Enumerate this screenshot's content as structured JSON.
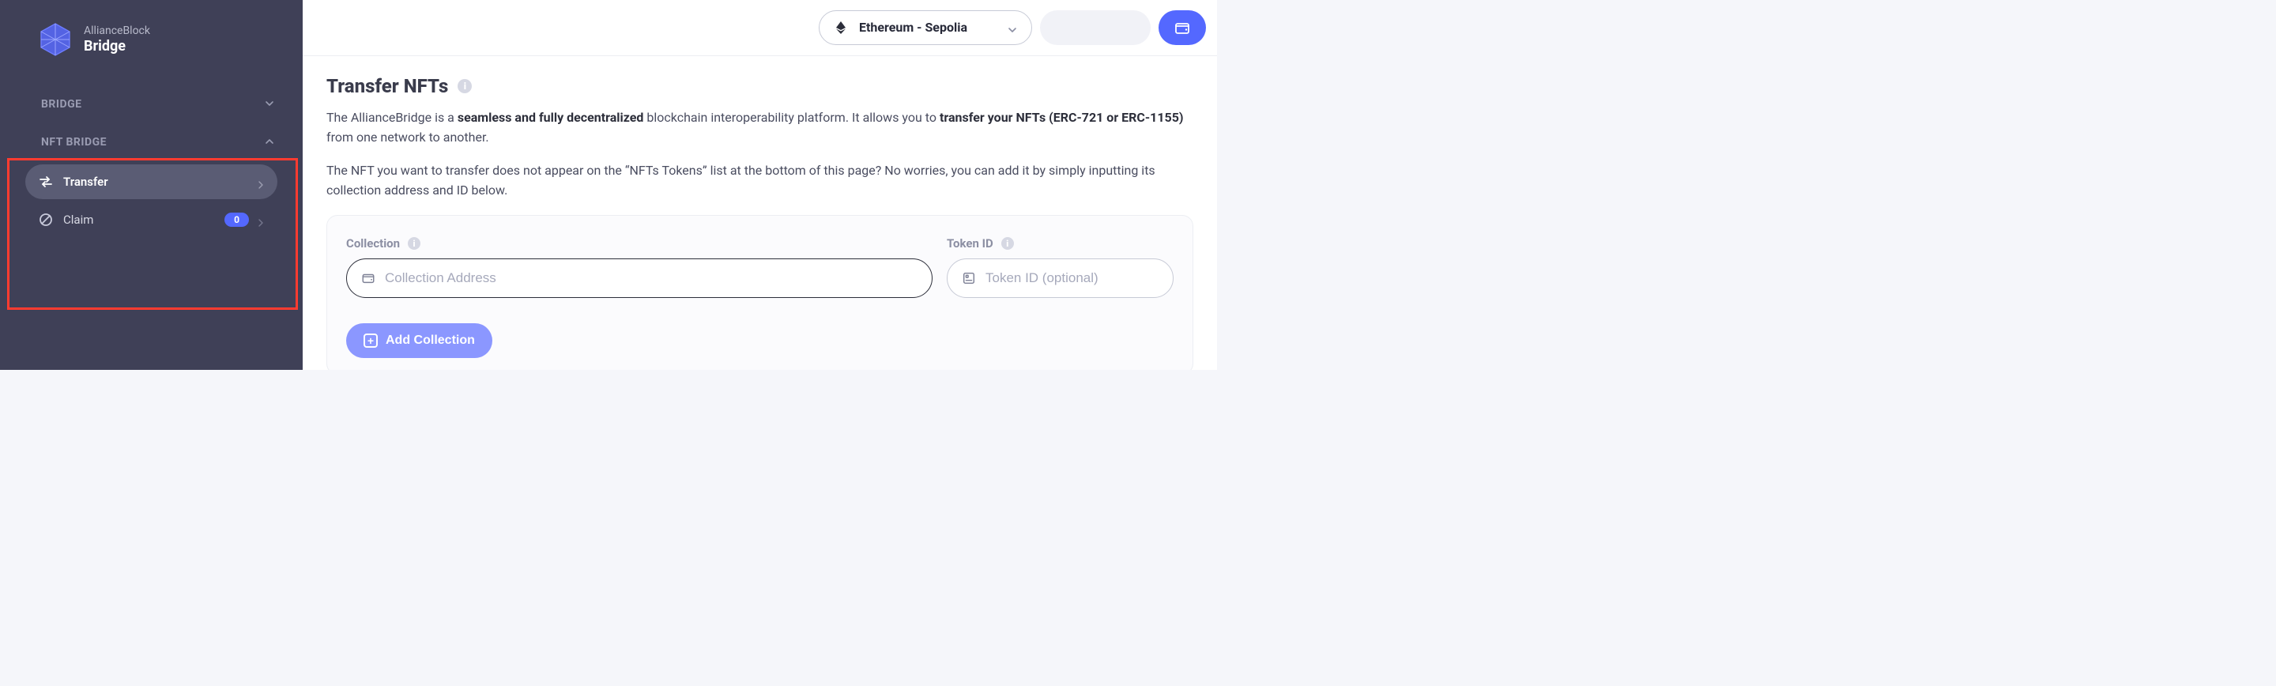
{
  "brand": {
    "top": "AllianceBlock",
    "bottom": "Bridge"
  },
  "sidebar": {
    "sections": [
      {
        "label": "BRIDGE",
        "expanded": false
      },
      {
        "label": "NFT BRIDGE",
        "expanded": true
      }
    ],
    "items": [
      {
        "label": "Transfer",
        "active": true
      },
      {
        "label": "Claim",
        "active": false,
        "badge": "0"
      }
    ]
  },
  "topbar": {
    "network_label": "Ethereum - Sepolia"
  },
  "page": {
    "title": "Transfer NFTs",
    "desc1_a": "The AllianceBridge is a ",
    "desc1_b": "seamless and fully decentralized",
    "desc1_c": " blockchain interoperability platform. It allows you to ",
    "desc1_d": "transfer your NFTs (ERC-721 or ERC-1155)",
    "desc1_e": " from one network to another.",
    "desc2": "The NFT you want to transfer does not appear on the “NFTs Tokens” list at the bottom of this page? No worries, you can add it by simply inputting its collection address and ID below."
  },
  "form": {
    "collection_label": "Collection",
    "collection_placeholder": "Collection Address",
    "tokenid_label": "Token ID",
    "tokenid_placeholder": "Token ID (optional)",
    "add_button": "Add Collection"
  }
}
